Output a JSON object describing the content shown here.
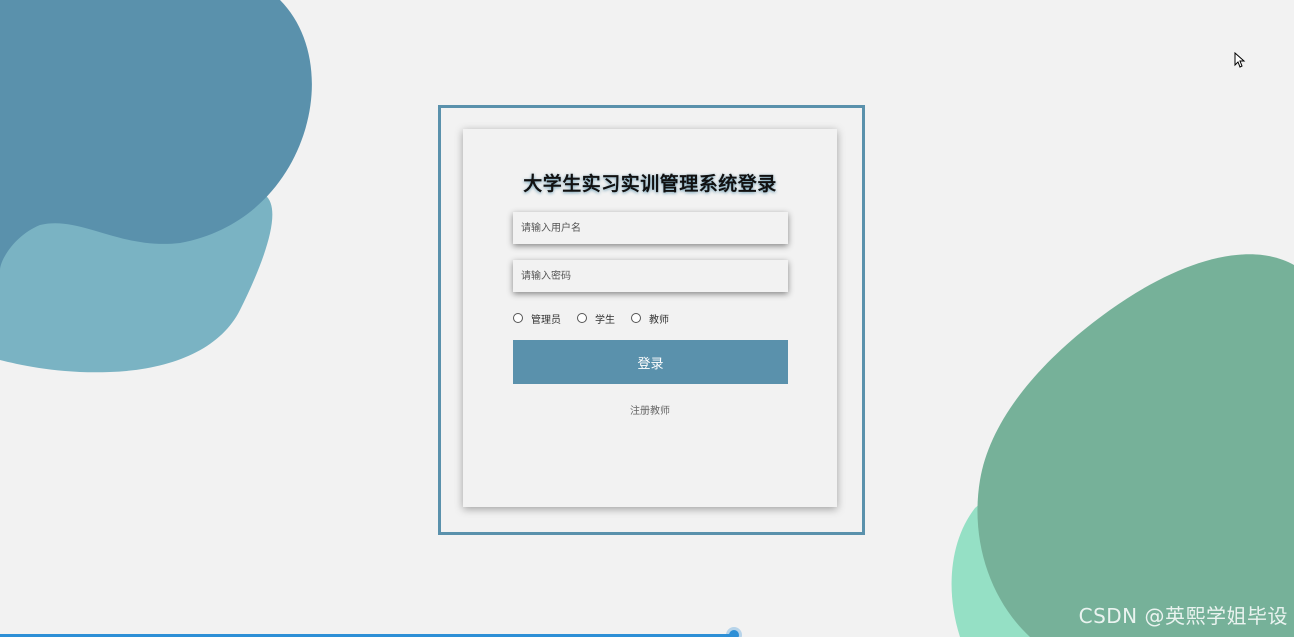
{
  "login": {
    "title": "大学生实习实训管理系统登录",
    "username_placeholder": "请输入用户名",
    "password_placeholder": "请输入密码",
    "roles": [
      {
        "label": "管理员"
      },
      {
        "label": "学生"
      },
      {
        "label": "教师"
      }
    ],
    "submit_label": "登录",
    "register_link": "注册教师"
  },
  "media_bar": {
    "progress": 0.567
  },
  "watermark": "CSDN @英熙学姐毕设",
  "colors": {
    "background": "#f2f2f2",
    "accent": "#5a91ac",
    "blob_blue_dark": "#5a91ac",
    "blob_blue_light": "#7ab3c3",
    "blob_green_dark": "#76b199",
    "blob_green_light": "#95e0c5",
    "progress": "#2d8fd6"
  }
}
